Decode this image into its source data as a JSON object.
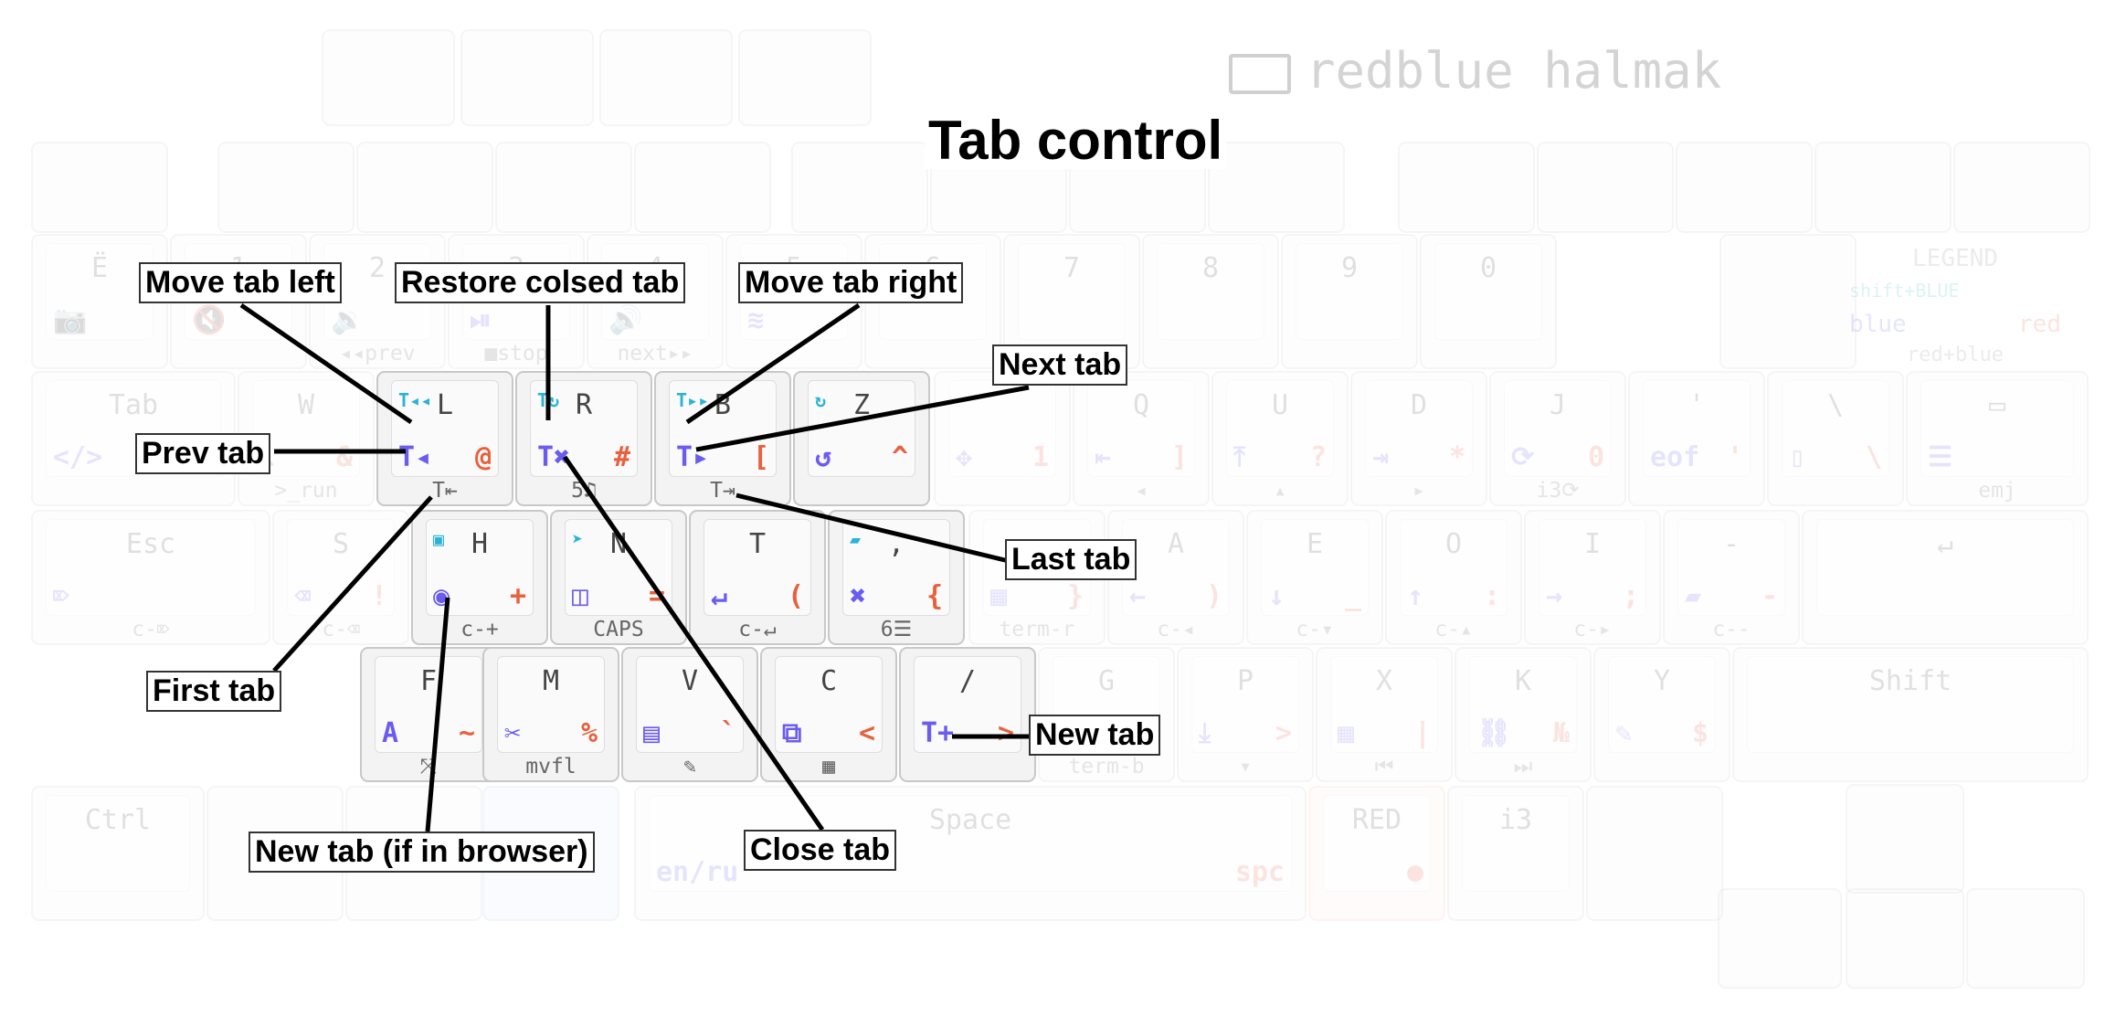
{
  "title": "Tab control",
  "brand": "redblue halmak",
  "legend": {
    "title": "LEGEND",
    "shift_blue": "shift+BLUE",
    "blue": "blue",
    "red": "red",
    "red_blue": "red+blue"
  },
  "highlighted_keys": [
    {
      "id": "L",
      "main": "L",
      "blue": "T◂",
      "red": "@",
      "shift_blue": "T◂◂",
      "bottom": "T⇤"
    },
    {
      "id": "R",
      "main": "R",
      "blue": "T✖",
      "red": "#",
      "shift_blue": "T↻",
      "bottom": "5♫"
    },
    {
      "id": "B",
      "main": "B",
      "blue": "T▸",
      "red": "[",
      "shift_blue": "T▸▸",
      "bottom": "T⇥"
    },
    {
      "id": "Z",
      "main": "Z",
      "blue": "↺",
      "red": "^",
      "shift_blue": "↻",
      "bottom": ""
    },
    {
      "id": "H",
      "main": "H",
      "blue": "◉",
      "red": "+",
      "shift_blue": "▣",
      "bottom": "c-+"
    },
    {
      "id": "N",
      "main": "N",
      "blue": "◫",
      "red": "=",
      "shift_blue": "➤",
      "bottom": "CAPS"
    },
    {
      "id": "T",
      "main": "T",
      "blue": "↵",
      "red": "(",
      "shift_blue": "",
      "bottom": "c-↵"
    },
    {
      "id": "comma",
      "main": ",",
      "blue": "✖",
      "red": "{",
      "shift_blue": "▰",
      "bottom": "6☰"
    },
    {
      "id": "F",
      "main": "F",
      "blue": "A",
      "red": "~",
      "shift_blue": "",
      "bottom": "⤧"
    },
    {
      "id": "M",
      "main": "M",
      "blue": "✂",
      "red": "%",
      "shift_blue": "",
      "bottom": "mvfl"
    },
    {
      "id": "V",
      "main": "V",
      "blue": "▤",
      "red": "`",
      "shift_blue": "",
      "bottom": "✎"
    },
    {
      "id": "C",
      "main": "C",
      "blue": "⧉",
      "red": "<",
      "shift_blue": "",
      "bottom": "▦"
    },
    {
      "id": "slash",
      "main": "/",
      "blue": "T+",
      "red": ">",
      "shift_blue": "",
      "bottom": ""
    }
  ],
  "faded_keys": [
    {
      "main": "Ё",
      "blue": "📷",
      "red": "",
      "bottom": ""
    },
    {
      "main": "1",
      "blue": "🔇",
      "red": "",
      "bottom": ""
    },
    {
      "main": "2",
      "blue": "🔉",
      "red": "",
      "bottom": "◂◂prev"
    },
    {
      "main": "3",
      "blue": "⏯",
      "red": "",
      "bottom": "■stop"
    },
    {
      "main": "4",
      "blue": "🔊",
      "red": "",
      "bottom": "next▸▸"
    },
    {
      "main": "5",
      "blue": "≋",
      "red": "",
      "bottom": ""
    },
    {
      "main": "6",
      "blue": "",
      "red": "",
      "bottom": ""
    },
    {
      "main": "7",
      "blue": "",
      "red": "",
      "bottom": ""
    },
    {
      "main": "8",
      "blue": "",
      "red": "",
      "bottom": ""
    },
    {
      "main": "9",
      "blue": "",
      "red": "",
      "bottom": ""
    },
    {
      "main": "0",
      "blue": "",
      "red": "",
      "bottom": ""
    },
    {
      "main": "Tab",
      "blue": "</>",
      "red": "",
      "bottom": ""
    },
    {
      "main": "W",
      "blue": "↖",
      "red": "&",
      "bottom": ">_run"
    },
    {
      "main": "",
      "blue": "✥",
      "red": "1",
      "bottom": ""
    },
    {
      "main": "Q",
      "blue": "⇤",
      "red": "]",
      "bottom": "◂"
    },
    {
      "main": "U",
      "blue": "⤒",
      "red": "?",
      "bottom": "▴"
    },
    {
      "main": "D",
      "blue": "⇥",
      "red": "*",
      "bottom": "▸"
    },
    {
      "main": "J",
      "blue": "⟳",
      "red": "0",
      "bottom": "i3⟳"
    },
    {
      "main": "'",
      "blue": "eof",
      "red": "'",
      "bottom": ""
    },
    {
      "main": "\\",
      "blue": "▯",
      "red": "\\",
      "bottom": ""
    },
    {
      "main": "▭",
      "blue": "☰",
      "red": "",
      "bottom": "emj"
    },
    {
      "main": "Esc",
      "blue": "⌦",
      "red": "",
      "bottom": "c-⌦"
    },
    {
      "main": "S",
      "blue": "⌫",
      "red": "!",
      "bottom": "c-⌫"
    },
    {
      "main": "",
      "blue": "▦",
      "red": "}",
      "bottom": "term-r"
    },
    {
      "main": "A",
      "blue": "←",
      "red": ")",
      "bottom": "c-◂"
    },
    {
      "main": "E",
      "blue": "↓",
      "red": "_",
      "bottom": "c-▾"
    },
    {
      "main": "O",
      "blue": "↑",
      "red": ":",
      "bottom": "c-▴"
    },
    {
      "main": "I",
      "blue": "→",
      "red": ";",
      "bottom": "c-▸"
    },
    {
      "main": "-",
      "blue": "▰",
      "red": "-",
      "bottom": "c--"
    },
    {
      "main": "↵",
      "blue": "",
      "red": "",
      "bottom": ""
    },
    {
      "main": "G",
      "blue": "",
      "red": "",
      "bottom": "term-b"
    },
    {
      "main": "P",
      "blue": "⤓",
      "red": ">",
      "bottom": "▾"
    },
    {
      "main": "X",
      "blue": "▦",
      "red": "|",
      "bottom": "⏮"
    },
    {
      "main": "K",
      "blue": "⛓",
      "red": "№",
      "bottom": "⏭"
    },
    {
      "main": "Y",
      "blue": "✎",
      "red": "$",
      "bottom": ""
    },
    {
      "main": "Shift",
      "blue": "",
      "red": "",
      "bottom": ""
    },
    {
      "main": "Ctrl",
      "blue": "",
      "red": "",
      "bottom": ""
    },
    {
      "main": "Space",
      "blue": "en/ru",
      "red": "spc",
      "bottom": ""
    },
    {
      "main": "RED",
      "blue": "",
      "red": "●",
      "bottom": ""
    },
    {
      "main": "i3",
      "blue": "",
      "red": "",
      "bottom": ""
    }
  ],
  "callouts": [
    {
      "id": "move-left",
      "text": "Move tab left"
    },
    {
      "id": "restore",
      "text": "Restore colsed tab"
    },
    {
      "id": "move-right",
      "text": "Move tab right"
    },
    {
      "id": "next",
      "text": "Next tab"
    },
    {
      "id": "prev",
      "text": "Prev tab"
    },
    {
      "id": "last",
      "text": "Last tab"
    },
    {
      "id": "first",
      "text": "First tab"
    },
    {
      "id": "new",
      "text": "New tab"
    },
    {
      "id": "new-browser",
      "text": "New tab (if in browser)"
    },
    {
      "id": "close",
      "text": "Close tab"
    }
  ]
}
